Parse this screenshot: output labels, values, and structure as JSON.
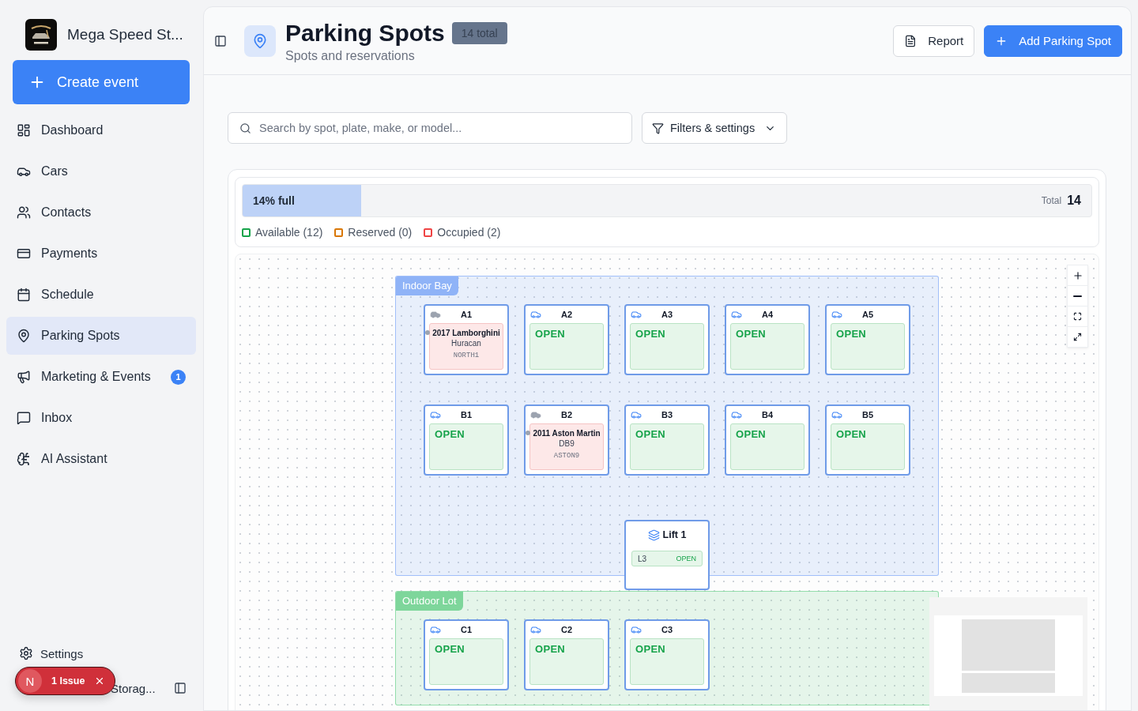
{
  "sidebar": {
    "brand": "Mega Speed St...",
    "create_button": "Create event",
    "items": [
      {
        "label": "Dashboard",
        "selected": false
      },
      {
        "label": "Cars",
        "selected": false
      },
      {
        "label": "Contacts",
        "selected": false
      },
      {
        "label": "Payments",
        "selected": false
      },
      {
        "label": "Schedule",
        "selected": false
      },
      {
        "label": "Parking Spots",
        "selected": true
      },
      {
        "label": "Marketing & Events",
        "selected": false,
        "badge": "1"
      },
      {
        "label": "Inbox",
        "selected": false
      },
      {
        "label": "AI Assistant",
        "selected": false
      }
    ],
    "settings": "Settings",
    "user_name": "Storag..."
  },
  "issue_indicator": {
    "initial": "N",
    "label": "1 Issue"
  },
  "header": {
    "title": "Parking Spots",
    "count_badge": "14 total",
    "subtitle": "Spots and reservations",
    "buttons": [
      {
        "label": "Report",
        "kind": "secondary"
      },
      {
        "label": "Add Parking Spot",
        "kind": "primary"
      }
    ]
  },
  "search": {
    "placeholder": "Search by spot, plate, make, or model..."
  },
  "filters_button": "Filters & settings",
  "occupancy": {
    "label": "14% full",
    "level": 0.14,
    "total_label": "Total",
    "total": "14",
    "legend": [
      {
        "label": "Available (12)",
        "color": "#16a34a"
      },
      {
        "label": "Reserved (0)",
        "color": "#d97706"
      },
      {
        "label": "Occupied (2)",
        "color": "#ef4444"
      }
    ]
  },
  "map": {
    "zones": [
      {
        "name": "Indoor Bay",
        "color": "#8fb3f7",
        "spots": [
          {
            "label": "A1",
            "occupied": true,
            "vehicle": "2017 Lamborghini",
            "model": "Huracan",
            "plate": "NORTH1"
          },
          {
            "label": "A2",
            "occupied": false,
            "state_text": "OPEN"
          },
          {
            "label": "A3",
            "occupied": false,
            "state_text": "OPEN"
          },
          {
            "label": "A4",
            "occupied": false,
            "state_text": "OPEN"
          },
          {
            "label": "A5",
            "occupied": false,
            "state_text": "OPEN"
          },
          {
            "label": "B1",
            "occupied": false,
            "state_text": "OPEN"
          },
          {
            "label": "B2",
            "occupied": true,
            "vehicle": "2011 Aston Martin",
            "model": "DB9",
            "plate": "ASTON9"
          },
          {
            "label": "B3",
            "occupied": false,
            "state_text": "OPEN"
          },
          {
            "label": "B4",
            "occupied": false,
            "state_text": "OPEN"
          },
          {
            "label": "B5",
            "occupied": false,
            "state_text": "OPEN"
          }
        ]
      },
      {
        "name": "Outdoor Lot",
        "color": "#7ed69b",
        "spots": [
          {
            "label": "C1",
            "occupied": false,
            "state_text": "OPEN"
          },
          {
            "label": "C2",
            "occupied": false,
            "state_text": "OPEN"
          },
          {
            "label": "C3",
            "occupied": false,
            "state_text": "OPEN"
          }
        ]
      }
    ],
    "lift": {
      "name": "Lift 1",
      "slots": [
        {
          "label": "L3",
          "state_text": "OPEN"
        }
      ]
    }
  }
}
